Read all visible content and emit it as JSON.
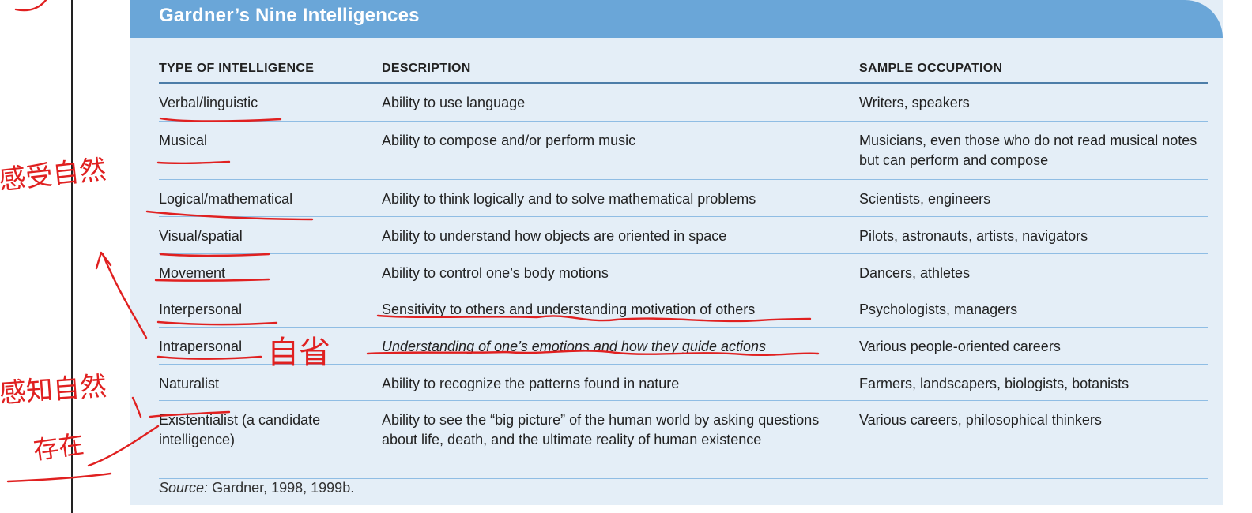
{
  "title": "Gardner’s Nine Intelligences",
  "columns": {
    "type": "TYPE OF INTELLIGENCE",
    "description": "DESCRIPTION",
    "occupation": "SAMPLE OCCUPATION"
  },
  "rows": [
    {
      "type": "Verbal/linguistic",
      "description": "Ability to use language",
      "occupation": "Writers, speakers"
    },
    {
      "type": "Musical",
      "description": "Ability to compose and/or perform music",
      "occupation": "Musicians, even those who do not read musical notes but can perform and compose"
    },
    {
      "type": "Logical/mathematical",
      "description": "Ability to think logically and to solve mathematical problems",
      "occupation": "Scientists, engineers"
    },
    {
      "type": "Visual/spatial",
      "description": "Ability to understand how objects are oriented in space",
      "occupation": "Pilots, astronauts, artists, navigators"
    },
    {
      "type": "Movement",
      "description": "Ability to control one’s body motions",
      "occupation": "Dancers, athletes"
    },
    {
      "type": "Interpersonal",
      "description": "Sensitivity to others and understanding motivation of others",
      "occupation": "Psychologists, managers"
    },
    {
      "type": "Intrapersonal",
      "description": "Understanding of one’s emotions and how they guide actions",
      "occupation": "Various people-oriented careers"
    },
    {
      "type": "Naturalist",
      "description": "Ability to recognize the patterns found in nature",
      "occupation": "Farmers, landscapers, biologists, botanists"
    },
    {
      "type": "Existentialist (a candidate intelligence)",
      "description": "Ability to see the “big picture” of the human world by asking questions about life, death, and the ultimate reality of human existence",
      "occupation": "Various careers, philosophical thinkers"
    }
  ],
  "source": {
    "label": "Source:",
    "text": "Gardner, 1998, 1999b."
  },
  "annotations": {
    "note_1": "感受自然",
    "note_2": "自省",
    "note_3": "感知自然",
    "note_4": "存在"
  },
  "colors": {
    "banner": "#6aa6d8",
    "card": "#e4eef7",
    "ink": "#e02020"
  }
}
